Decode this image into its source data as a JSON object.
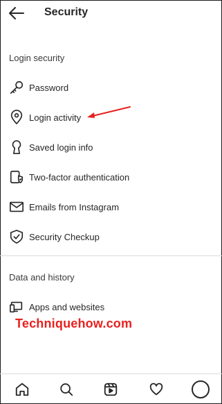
{
  "header": {
    "title": "Security"
  },
  "sections": {
    "login_security": "Login security",
    "data_history": "Data and history"
  },
  "items": {
    "password": "Password",
    "login_activity": "Login activity",
    "saved_login": "Saved login info",
    "two_factor": "Two-factor authentication",
    "emails": "Emails from Instagram",
    "checkup": "Security Checkup",
    "apps": "Apps and websites"
  },
  "watermark": "Techniquehow.com",
  "colors": {
    "accent": "#e8211f",
    "text": "#262626",
    "divider": "#dbdbdb"
  },
  "icons": {
    "back": "arrow-left-icon",
    "password": "key-icon",
    "login_activity": "location-pin-icon",
    "saved_login": "keyhole-icon",
    "two_factor": "shield-phone-icon",
    "emails": "mail-icon",
    "checkup": "shield-check-icon",
    "apps": "devices-icon"
  },
  "nav": [
    "home-icon",
    "search-icon",
    "reels-icon",
    "heart-icon",
    "profile-avatar"
  ]
}
